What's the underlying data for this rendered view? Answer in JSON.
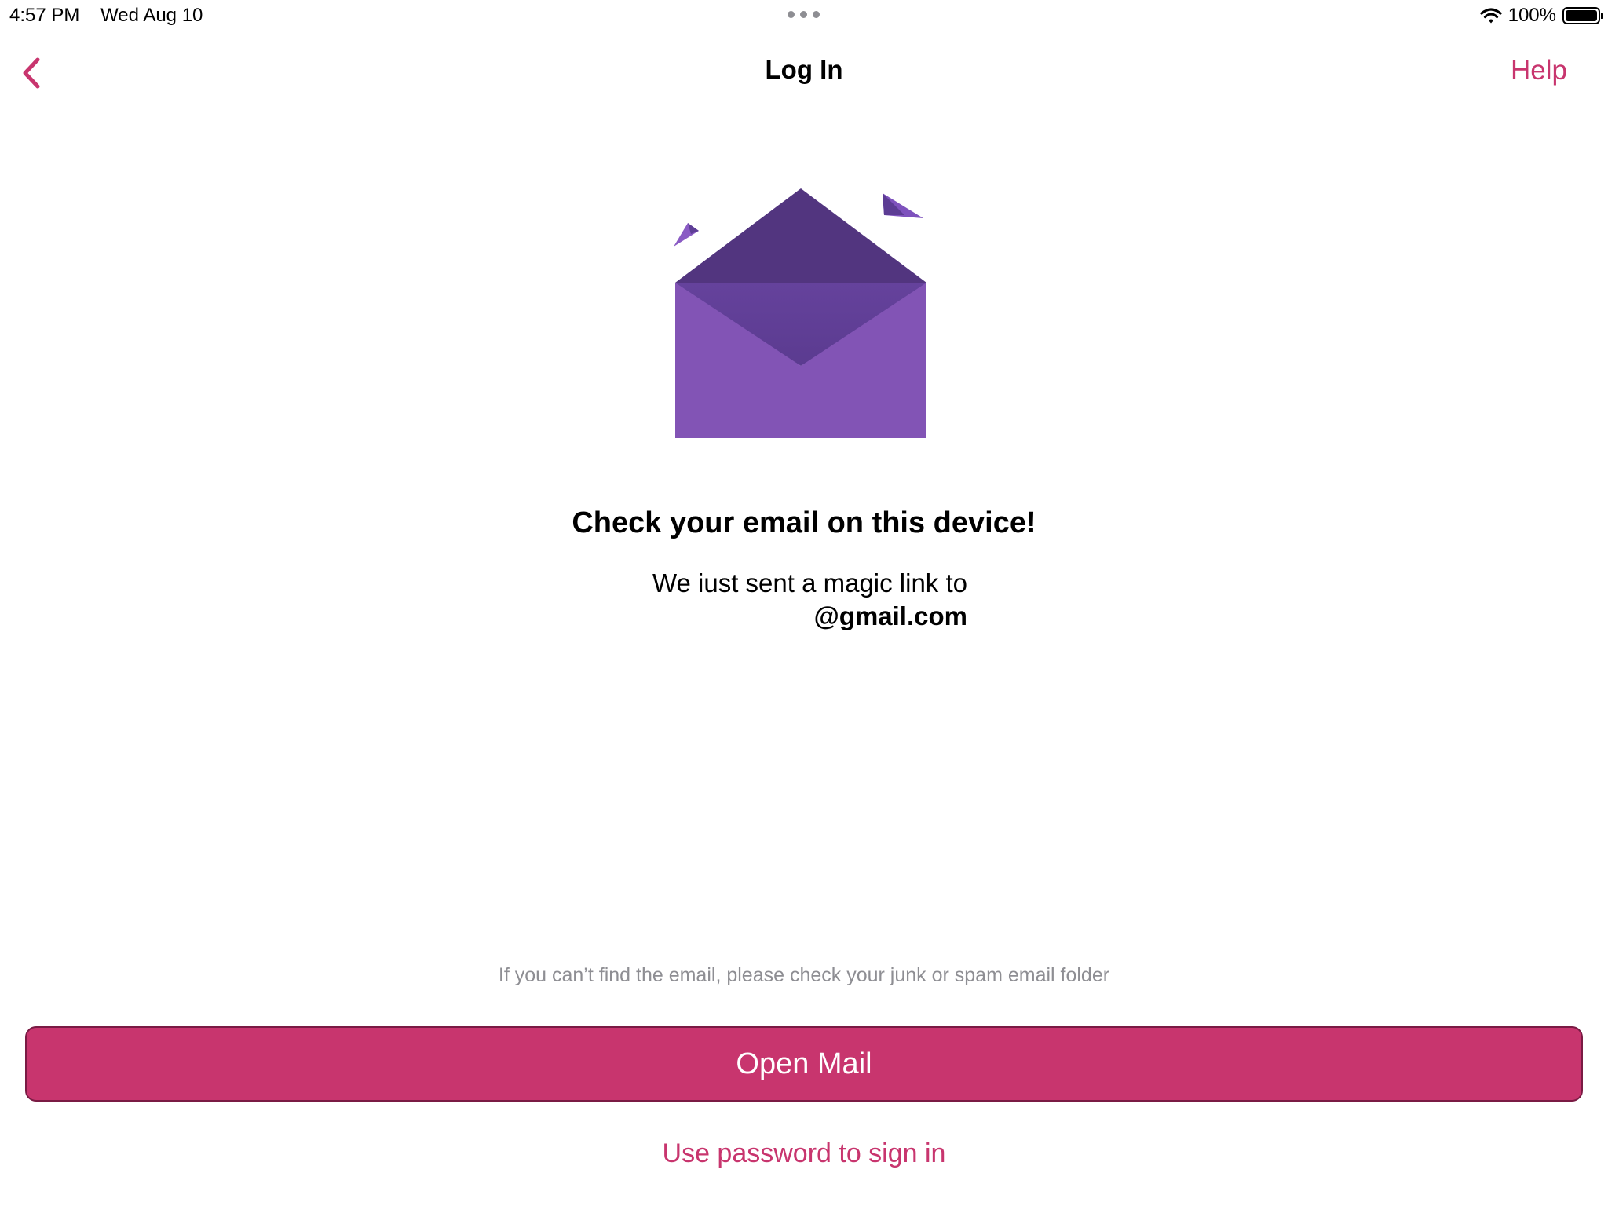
{
  "status_bar": {
    "time": "4:57 PM",
    "date": "Wed Aug 10",
    "battery": "100%"
  },
  "nav": {
    "title": "Log In",
    "help_label": "Help"
  },
  "main": {
    "headline": "Check your email on this device!",
    "message_line1": "We iust sent a magic link to",
    "email": "@gmail.com",
    "hint": "If you can’t find the email, please check your junk or spam email folder"
  },
  "actions": {
    "open_mail_label": "Open Mail",
    "password_link_label": "Use password to sign in"
  },
  "colors": {
    "accent": "#c8356e",
    "envelope_light": "#8254b5",
    "envelope_dark": "#52357f"
  }
}
